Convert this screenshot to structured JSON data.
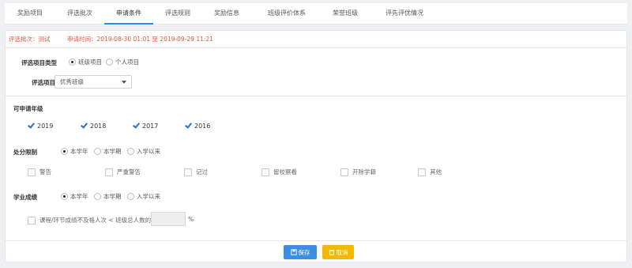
{
  "tabs": [
    {
      "label": "奖励项目"
    },
    {
      "label": "评选批次"
    },
    {
      "label": "申请条件"
    },
    {
      "label": "评选规则"
    },
    {
      "label": "奖励信息"
    },
    {
      "label": "班级评价体系"
    },
    {
      "label": "荣誉班级"
    },
    {
      "label": "评先评优情况"
    }
  ],
  "info": {
    "batch": "评选批次：测试",
    "time": "申请时间：2019-08-30 01:01 至 2019-09-29 11:21"
  },
  "type_section": {
    "label": "评选项目类型",
    "options": [
      "班级项目",
      "个人项目"
    ],
    "selected": "班级项目",
    "item_label": "评选项目",
    "item_value": "优秀班级"
  },
  "grades": {
    "label": "可申请年级",
    "options": [
      "2019",
      "2018",
      "2017",
      "2016"
    ]
  },
  "punishment": {
    "label": "处分限制",
    "options": [
      "本学年",
      "本学期",
      "入学以来"
    ],
    "selected": "本学年",
    "types": [
      "警告",
      "严重警告",
      "记过",
      "留校察看",
      "开除学籍",
      "其他"
    ]
  },
  "academic": {
    "label": "学业成绩",
    "options": [
      "本学年",
      "本学期",
      "入学以来"
    ],
    "selected": "本学年",
    "condition": "课程/环节成绩不及格人次 < 班级总人数的",
    "unit": "%"
  },
  "buttons": {
    "save": "保存",
    "cancel": "取消"
  },
  "colors": {
    "accent": "#2d8cf0",
    "save": "#3a8ee6",
    "cancel": "#f5b800",
    "info_text": "#e8503c"
  }
}
